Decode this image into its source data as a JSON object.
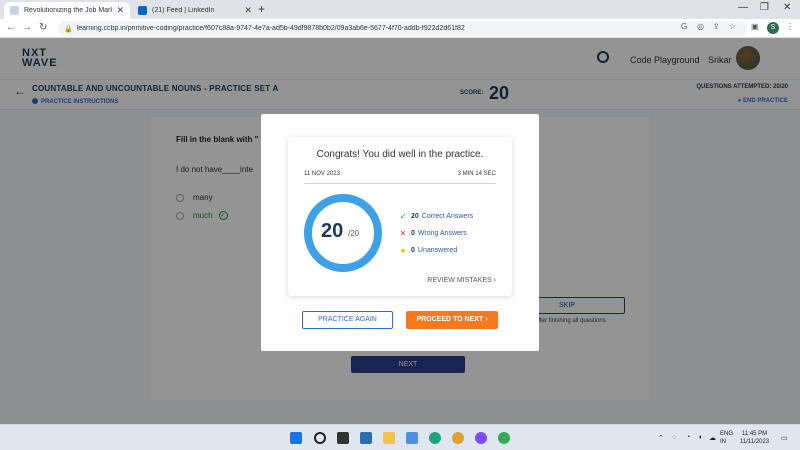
{
  "browser": {
    "tabs": [
      {
        "title": "Revolutionizing the Job Market",
        "active": true
      },
      {
        "title": "(21) Feed | LinkedIn",
        "active": false
      }
    ],
    "url": "learning.ccbp.in/primitive-coding/practice/f607c88a-9747-4e7a-ad5b-49df9878b0b2/09a3ab6e-5677-4f70-addb-f922d2d61f82",
    "profile_initial": "S"
  },
  "header": {
    "logo_line1": "NXT",
    "logo_line2": "WAVE",
    "playground": "Code Playground",
    "username": "Srikar"
  },
  "practice": {
    "title": "COUNTABLE AND UNCOUNTABLE NOUNS - PRACTICE SET A",
    "instructions": "PRACTICE INSTRUCTIONS",
    "score_label": "SCORE:",
    "score_value": "20",
    "attempted": "QUESTIONS ATTEMPTED: 20/20",
    "end_practice": "END PRACTICE"
  },
  "question": {
    "instruction": "Fill in the blank with \"",
    "text": "I do not have____inte",
    "options": [
      {
        "label": "many",
        "correct": false
      },
      {
        "label": "much",
        "correct": true
      }
    ],
    "skip_label": "SKIP",
    "skip_note": "after finishing all questions",
    "next_label": "NEXT"
  },
  "modal": {
    "congrats": "Congrats! You did well in the practice.",
    "date": "11 NOV 2023",
    "duration": "3 MIN 14 SEC",
    "score": "20",
    "total": "/20",
    "stats": [
      {
        "count": "20",
        "label": "Correct Answers",
        "icon": "check-icon",
        "color": "#1d8f3a"
      },
      {
        "count": "0",
        "label": "Wrong Answers",
        "icon": "cross-icon",
        "color": "#e53935"
      },
      {
        "count": "0",
        "label": "Unanswered",
        "icon": "dot-icon",
        "color": "#f5b400"
      }
    ],
    "review": "REVIEW MISTAKES",
    "practice_again": "PRACTICE AGAIN",
    "proceed": "PROCEED TO NEXT"
  },
  "taskbar": {
    "lang_line1": "ENG",
    "lang_line2": "IN",
    "time": "11:45 PM",
    "date": "11/11/2023"
  }
}
